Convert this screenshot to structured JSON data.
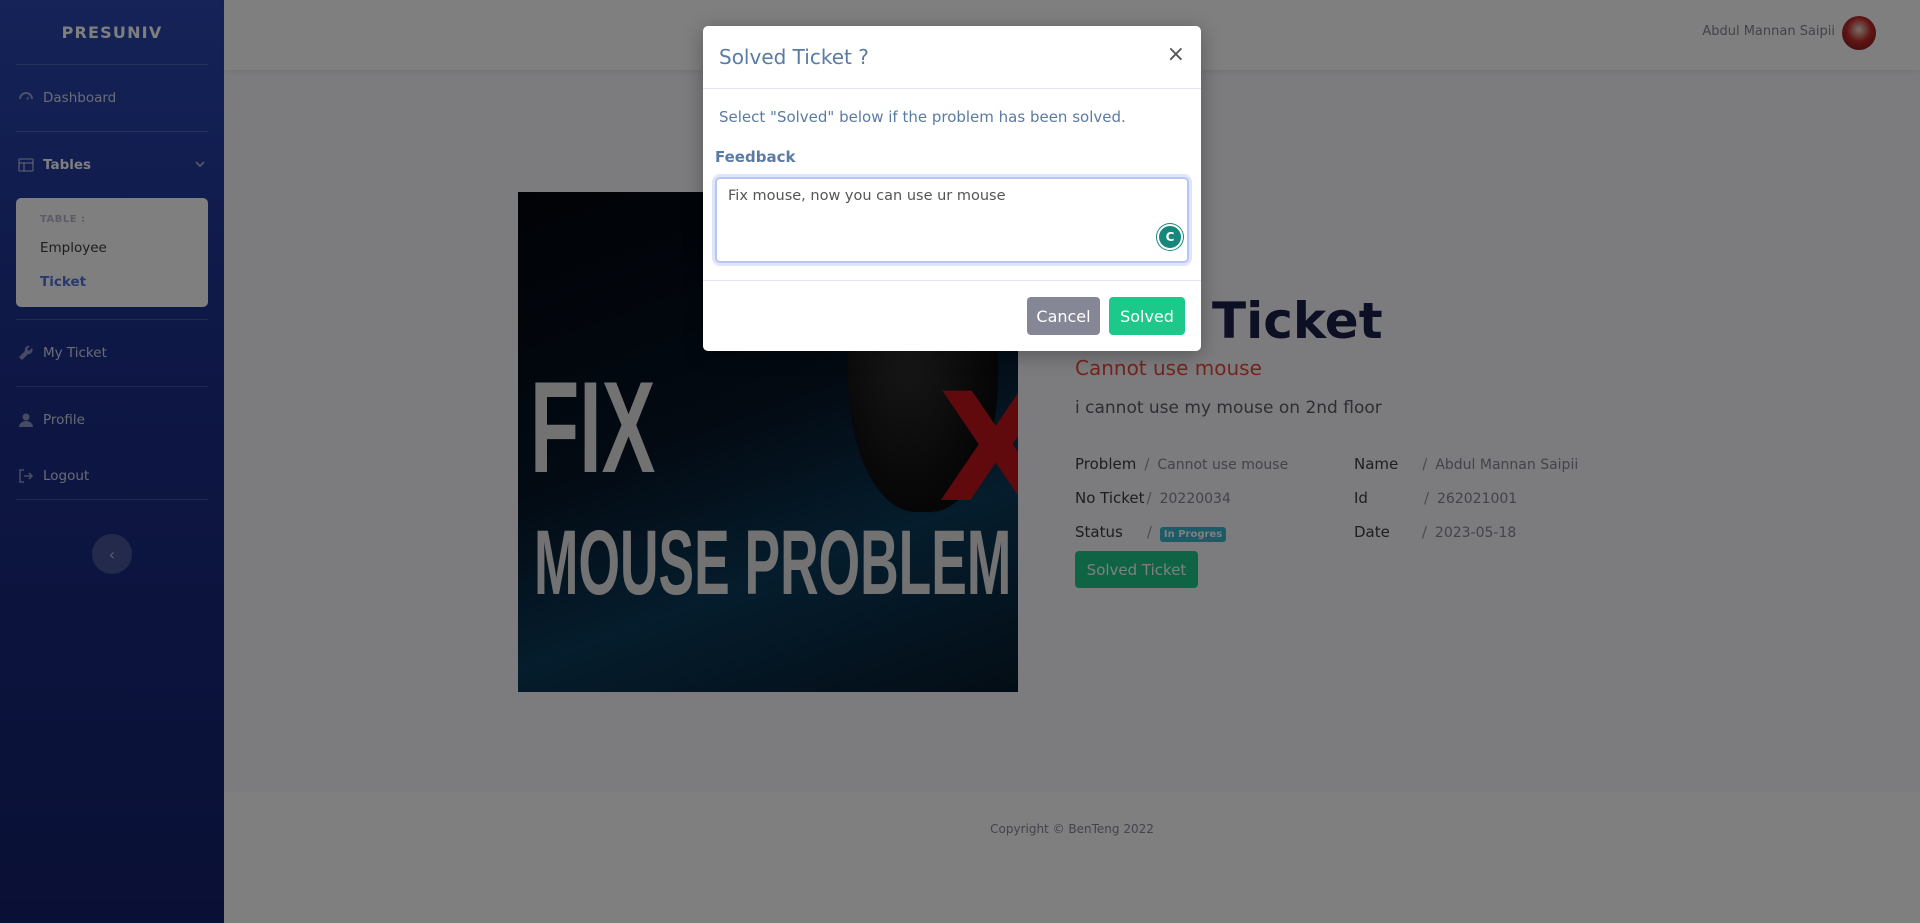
{
  "sidebar": {
    "brand": "PRESUNIV",
    "dashboard": "Dashboard",
    "tables": "Tables",
    "table_header": "TABLE :",
    "table_items": [
      "Employee",
      "Ticket"
    ],
    "my_ticket": "My Ticket",
    "profile": "Profile",
    "logout": "Logout",
    "toggle": "‹"
  },
  "topbar": {
    "user_name": "Abdul Mannan Saipii"
  },
  "image": {
    "line1": "FIX",
    "line2": "MOUSE PROBLEM",
    "x_mark": "X"
  },
  "ticket": {
    "title": "Ticket",
    "problem_heading": "Cannot use mouse",
    "description": "i cannot use my mouse on 2nd floor",
    "fields": {
      "problem_label": "Problem",
      "problem_value": "Cannot use mouse",
      "no_ticket_label": "No Ticket",
      "no_ticket_value": "20220034",
      "status_label": "Status",
      "status_value": "In Progres",
      "name_label": "Name",
      "name_value": "Abdul Mannan Saipii",
      "id_label": "Id",
      "id_value": "262021001",
      "date_label": "Date",
      "date_value": "2023-05-18",
      "separator": "/"
    },
    "solved_button": "Solved Ticket"
  },
  "footer": {
    "copyright": "Copyright © BenTeng 2022"
  },
  "modal": {
    "title": "Solved Ticket ?",
    "close": "×",
    "body_text": "Select \"Solved\" below if the problem has been solved.",
    "feedback_label": "Feedback",
    "feedback_value": "Fix mouse, now you can use ur mouse",
    "grammar_icon": "C",
    "cancel": "Cancel",
    "solved": "Solved"
  },
  "colors": {
    "primary": "#4e73df",
    "success": "#1cc88a",
    "danger": "#e74a3b",
    "info": "#36b9cc",
    "secondary": "#858796"
  }
}
